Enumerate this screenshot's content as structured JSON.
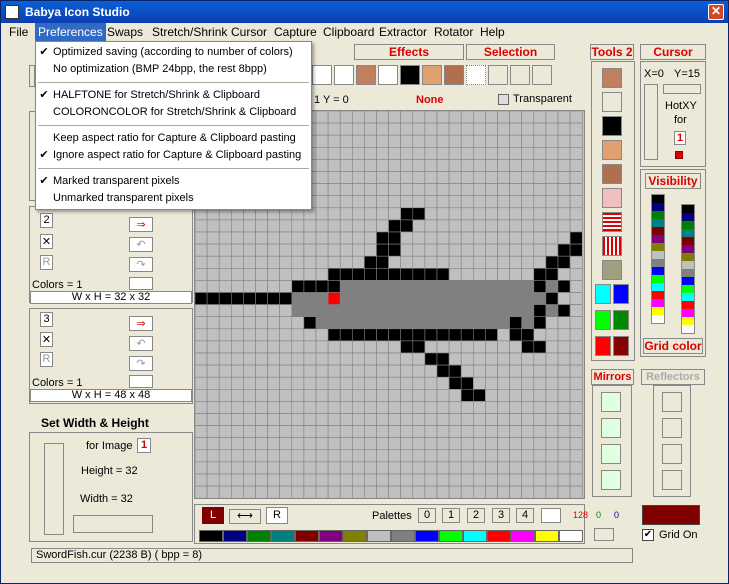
{
  "window": {
    "title": "Babya Icon Studio",
    "close_glyph": "✕"
  },
  "menu": {
    "items": [
      "File",
      "Preferences",
      "Swaps",
      "Stretch/Shrink",
      "Cursor",
      "Capture",
      "Clipboard",
      "Extractor",
      "Rotator",
      "Help"
    ],
    "open": "Preferences"
  },
  "prefs_menu": [
    {
      "label": "Optimized saving (according to number of colors)",
      "checked": true
    },
    {
      "label": "No optimization (BMP 24bpp, the rest 8bpp)",
      "checked": false
    },
    {
      "label": "HALFTONE for Stretch/Shrink & Clipboard",
      "checked": true
    },
    {
      "label": "COLORONCOLOR for Stretch/Shrink & Clipboard",
      "checked": false
    },
    {
      "label": "Keep aspect ratio for Capture & Clipboard pasting",
      "checked": false
    },
    {
      "label": "Ignore aspect ratio for Capture & Clipboard pasting",
      "checked": true
    },
    {
      "label": "Marked transparent pixels",
      "checked": true
    },
    {
      "label": "Unmarked transparent pixels",
      "checked": false
    }
  ],
  "check_glyph": "✔",
  "headers": {
    "effects": "Effects",
    "selection": "Selection",
    "tools2": "Tools 2",
    "cursor": "Cursor",
    "visibility": "Visibility",
    "grid_color": "Grid color",
    "mirrors": "Mirrors",
    "reflectors": "Reflectors"
  },
  "coords": {
    "y_label": "1    Y = 0",
    "color_name": "None",
    "transparent": "Transparent"
  },
  "cursor_panel": {
    "x": "X=0",
    "y": "Y=15",
    "hotxy": "HotXY",
    "for": "for",
    "num": "1"
  },
  "images": [
    {
      "num": "2",
      "colors": "Colors = 1",
      "wh": "W x H = 32 x 32"
    },
    {
      "num": "3",
      "colors": "Colors = 1",
      "wh": "W x H = 48 x 48"
    }
  ],
  "set_wh": {
    "title": "Set Width & Height",
    "for_image": "for Image",
    "image_num": "1",
    "height": "Height = 32",
    "width": "Width  = 32"
  },
  "palette": {
    "left": "L",
    "right": "R",
    "label": "Palettes",
    "buttons": [
      "0",
      "1",
      "2",
      "3",
      "4"
    ],
    "r": "128",
    "g": "0",
    "b": "0",
    "grid_on": "Grid On"
  },
  "status": "SwordFish.cur (2238 B) ( bpp = 8)",
  "palette_colors": [
    "#000000",
    "#000080",
    "#008000",
    "#008080",
    "#800000",
    "#800080",
    "#808000",
    "#c0c0c0",
    "#808080",
    "#0000ff",
    "#00ff00",
    "#00ffff",
    "#ff0000",
    "#ff00ff",
    "#ffff00",
    "#ffffff"
  ],
  "vis_col1": [
    "#000000",
    "#000080",
    "#008000",
    "#008080",
    "#800000",
    "#800080",
    "#808000",
    "#c0c0c0",
    "#808080",
    "#0000ff",
    "#00ff00",
    "#00ffff",
    "#ff0000",
    "#ff00ff",
    "#ffff00",
    "#ffffff"
  ],
  "accent": "#cc0000"
}
